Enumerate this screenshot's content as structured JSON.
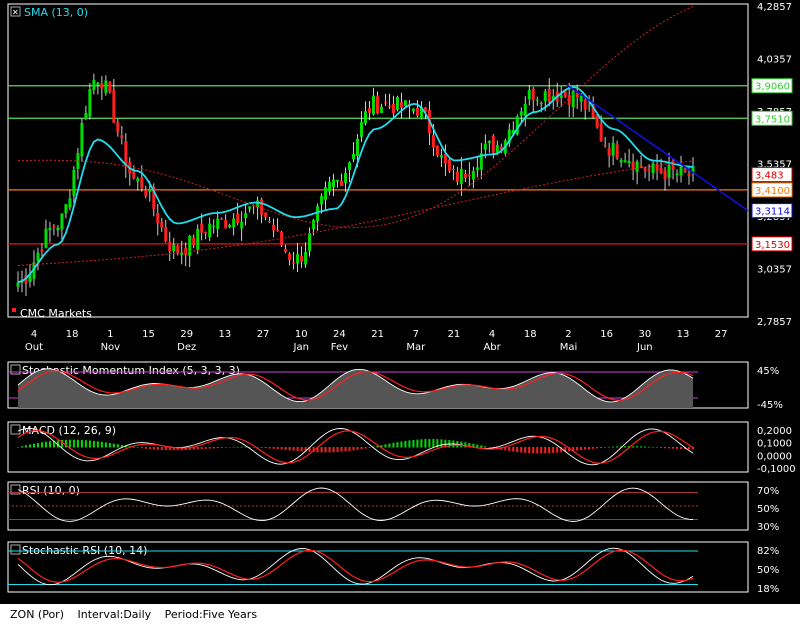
{
  "colors": {
    "bg": "#000000",
    "up": "#00dd00",
    "down": "#ff2020",
    "sma": "#22ddee",
    "hline_green": "#55dd55",
    "hline_orange": "#ff7700",
    "hline_red": "#ee1111",
    "trend": "#1010dd",
    "dotted": "#cc2222",
    "axis_label_bg": "#ffffff"
  },
  "footer": {
    "symbol": "ZON (Por)",
    "interval": "Interval:Daily",
    "period": "Period:Five Years"
  },
  "main_panel": {
    "indicator_label": "SMA (13, 0)",
    "watermark": "CMC Markets",
    "y_ticks": [
      "4,2857",
      "4,0357",
      "3,7857",
      "3,5357",
      "3,2857",
      "3,0357",
      "2,7857"
    ],
    "price_tags": [
      {
        "label": "3,9060",
        "value": 3.906,
        "color": "#33cc33"
      },
      {
        "label": "3,7510",
        "value": 3.751,
        "color": "#33cc33"
      },
      {
        "label": "3,483",
        "value": 3.483,
        "color": "#dd0000"
      },
      {
        "label": "3,4100",
        "value": 3.41,
        "color": "#ff7700"
      },
      {
        "label": "3,3114",
        "value": 3.3114,
        "color": "#1010dd"
      },
      {
        "label": "3,1530",
        "value": 3.153,
        "color": "#dd0000"
      }
    ],
    "x_tick_numbers": [
      "4",
      "18",
      "1",
      "15",
      "29",
      "13",
      "27",
      "10",
      "24",
      "21",
      "7",
      "21",
      "4",
      "18",
      "2",
      "16",
      "30",
      "13",
      "27"
    ],
    "x_month_labels": [
      "Out",
      "Nov",
      "Dez",
      "Jan",
      "Fev",
      "Mar",
      "Abr",
      "Mai",
      "Jun"
    ]
  },
  "sub_panels": [
    {
      "label": "Stochastic Momentum Index (5, 3, 3, 3)",
      "ticks": [
        "45%",
        "-45%"
      ]
    },
    {
      "label": "MACD (12, 26, 9)",
      "ticks": [
        "0,2000",
        "0,1000",
        "0,0000",
        "-0,1000"
      ]
    },
    {
      "label": "RSI (10, 0)",
      "ticks": [
        "70%",
        "50%",
        "30%"
      ]
    },
    {
      "label": "Stochastic RSI (10, 14)",
      "ticks": [
        "82%",
        "50%",
        "18%"
      ]
    }
  ],
  "chart_data": {
    "type": "candlestick",
    "title": "ZON (Por)",
    "ylim": [
      2.7857,
      4.2857
    ],
    "x": [
      "4",
      "18",
      "1",
      "15",
      "29",
      "13",
      "27",
      "10",
      "24",
      "21",
      "7",
      "21",
      "4",
      "18",
      "2",
      "16",
      "30",
      "13"
    ],
    "close_approx": [
      2.97,
      3.25,
      3.95,
      3.45,
      3.12,
      3.25,
      3.32,
      3.08,
      3.45,
      3.82,
      3.8,
      3.47,
      3.62,
      3.87,
      3.86,
      3.6,
      3.5,
      3.48
    ],
    "sma_13_approx": [
      2.97,
      3.15,
      3.65,
      3.5,
      3.25,
      3.3,
      3.35,
      3.28,
      3.32,
      3.7,
      3.82,
      3.55,
      3.58,
      3.78,
      3.9,
      3.7,
      3.55,
      3.52
    ],
    "horizontal_levels": [
      3.906,
      3.751,
      3.41,
      3.153
    ],
    "trendline": {
      "start": [
        2,
        3.91
      ],
      "end_value": 3.3114
    },
    "last_close": 3.483
  }
}
